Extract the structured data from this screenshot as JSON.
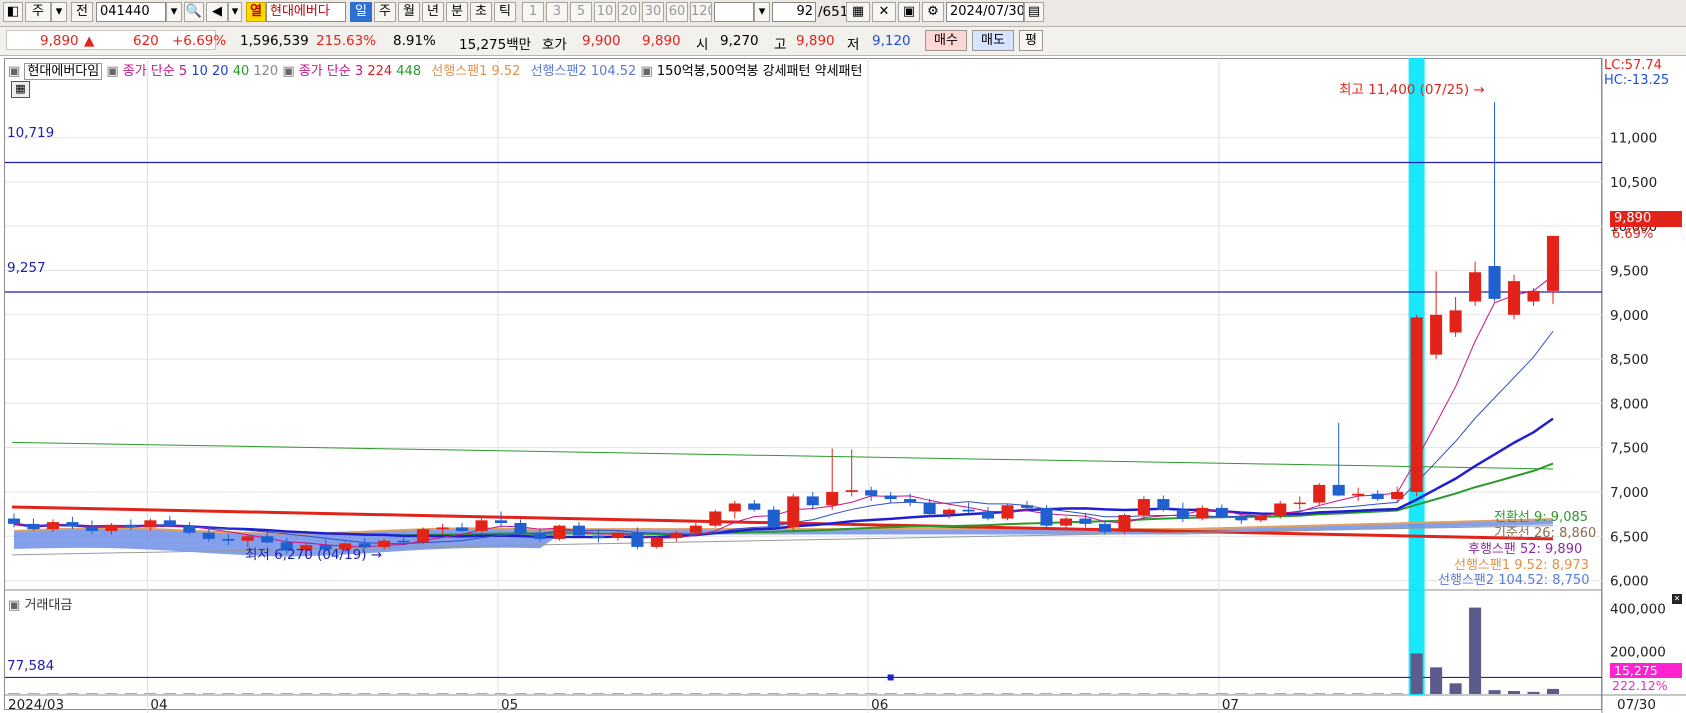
{
  "toolbar": {
    "market_label": "주",
    "prefix_label": "전",
    "code": "041440",
    "hot_label": "열",
    "stock_name": "현대에버다",
    "periods": [
      "일",
      "주",
      "월",
      "년",
      "분",
      "초",
      "틱"
    ],
    "selected_period": "일",
    "intervals": [
      "1",
      "3",
      "5",
      "10",
      "20",
      "30",
      "60",
      "120"
    ],
    "count_value": "92",
    "count_total": "/651",
    "date_value": "2024/07/30",
    "icons": [
      "layout-icon",
      "dropdown-icon",
      "search-icon",
      "speaker-icon",
      "settings-icon",
      "save-icon",
      "calendar-icon"
    ]
  },
  "quote": {
    "price": "9,890",
    "change_arrow": "▲",
    "change": "620",
    "change_pct": "+6.69%",
    "volume": "1,596,539",
    "volume_ratio": "215.63%",
    "turnover_pct": "8.91%",
    "trade_value": "15,275백만",
    "ask_label": "호가",
    "ask": "9,900",
    "bid": "9,890",
    "open_label": "시",
    "open": "9,270",
    "high_label": "고",
    "high": "9,890",
    "low_label": "저",
    "low": "9,120",
    "buy_label": "매수",
    "sell_label": "매도",
    "flat_label": "평"
  },
  "legend": {
    "name": "현대에버다임",
    "ma1": "종가 단순 5",
    "ma1_b": "10",
    "ma1_c": "20",
    "ma1_d": "40",
    "ma1_e": "120",
    "ma2": "종가 단순 3",
    "ma2_b": "224",
    "ma2_c": "448",
    "span1": "선행스팬1 9.52",
    "span2": "선행스팬2 104.52",
    "pattern": "150억봉,500억봉 강세패턴 약세패턴",
    "volume_panel": "거래대금"
  },
  "annotations": {
    "lc": "LC:57.74",
    "hc": "HC:-13.25",
    "high_note": "최고 11,400 (07/25)",
    "low_note": "최저 6,270 (04/19)",
    "line_10719": "10,719",
    "line_9257": "9,257",
    "vol_line": "77,584",
    "last_price": "9,890",
    "last_pct": "6.69%",
    "conv": "전환선 9: 9,085",
    "base": "기준선 26: 8,860",
    "lag": "후행스팬 52: 9,890",
    "lead1": "선행스팬1 9.52: 8,973",
    "lead2": "선행스팬2 104.52: 8,750",
    "vol_last": "15,275",
    "vol_pct": "222.12%"
  },
  "colors": {
    "up": "#e2231a",
    "down": "#1f5fd0",
    "highlight": "#00e5ff",
    "cloud": "#6f8fe8",
    "cloud_border": "#e0a060",
    "volume_bar": "#5b5b8c"
  },
  "chart_data": {
    "type": "candlestick",
    "y_axis_price": [
      "11,000",
      "10,500",
      "10,000",
      "9,500",
      "9,000",
      "8,500",
      "8,000",
      "7,500",
      "7,000",
      "6,500",
      "6,000"
    ],
    "y_axis_volume": [
      "400,000",
      "200,000"
    ],
    "x_labels": [
      "2024/03",
      "04",
      "05",
      "06",
      "07",
      "07/30"
    ],
    "ylim": [
      5950,
      11650
    ],
    "candles": [
      {
        "o": 6700,
        "h": 6760,
        "l": 6600,
        "c": 6640
      },
      {
        "o": 6640,
        "h": 6700,
        "l": 6560,
        "c": 6580
      },
      {
        "o": 6580,
        "h": 6690,
        "l": 6550,
        "c": 6660
      },
      {
        "o": 6660,
        "h": 6720,
        "l": 6580,
        "c": 6610
      },
      {
        "o": 6610,
        "h": 6680,
        "l": 6530,
        "c": 6560
      },
      {
        "o": 6560,
        "h": 6650,
        "l": 6520,
        "c": 6630
      },
      {
        "o": 6630,
        "h": 6690,
        "l": 6570,
        "c": 6600
      },
      {
        "o": 6600,
        "h": 6700,
        "l": 6560,
        "c": 6680
      },
      {
        "o": 6680,
        "h": 6730,
        "l": 6600,
        "c": 6620
      },
      {
        "o": 6620,
        "h": 6660,
        "l": 6520,
        "c": 6540
      },
      {
        "o": 6540,
        "h": 6600,
        "l": 6440,
        "c": 6470
      },
      {
        "o": 6470,
        "h": 6530,
        "l": 6400,
        "c": 6450
      },
      {
        "o": 6450,
        "h": 6520,
        "l": 6380,
        "c": 6500
      },
      {
        "o": 6500,
        "h": 6560,
        "l": 6420,
        "c": 6430
      },
      {
        "o": 6430,
        "h": 6480,
        "l": 6300,
        "c": 6340
      },
      {
        "o": 6340,
        "h": 6420,
        "l": 6270,
        "c": 6400
      },
      {
        "o": 6400,
        "h": 6460,
        "l": 6330,
        "c": 6350
      },
      {
        "o": 6350,
        "h": 6440,
        "l": 6320,
        "c": 6420
      },
      {
        "o": 6420,
        "h": 6480,
        "l": 6360,
        "c": 6380
      },
      {
        "o": 6380,
        "h": 6470,
        "l": 6350,
        "c": 6450
      },
      {
        "o": 6450,
        "h": 6510,
        "l": 6400,
        "c": 6430
      },
      {
        "o": 6430,
        "h": 6600,
        "l": 6410,
        "c": 6580
      },
      {
        "o": 6580,
        "h": 6640,
        "l": 6520,
        "c": 6600
      },
      {
        "o": 6600,
        "h": 6650,
        "l": 6540,
        "c": 6560
      },
      {
        "o": 6560,
        "h": 6700,
        "l": 6540,
        "c": 6680
      },
      {
        "o": 6680,
        "h": 6780,
        "l": 6600,
        "c": 6650
      },
      {
        "o": 6650,
        "h": 6690,
        "l": 6520,
        "c": 6540
      },
      {
        "o": 6540,
        "h": 6590,
        "l": 6440,
        "c": 6470
      },
      {
        "o": 6470,
        "h": 6630,
        "l": 6450,
        "c": 6620
      },
      {
        "o": 6620,
        "h": 6660,
        "l": 6500,
        "c": 6510
      },
      {
        "o": 6510,
        "h": 6560,
        "l": 6430,
        "c": 6480
      },
      {
        "o": 6480,
        "h": 6560,
        "l": 6450,
        "c": 6540
      },
      {
        "o": 6540,
        "h": 6600,
        "l": 6350,
        "c": 6380
      },
      {
        "o": 6380,
        "h": 6500,
        "l": 6360,
        "c": 6480
      },
      {
        "o": 6480,
        "h": 6560,
        "l": 6440,
        "c": 6540
      },
      {
        "o": 6540,
        "h": 6650,
        "l": 6500,
        "c": 6620
      },
      {
        "o": 6620,
        "h": 6800,
        "l": 6600,
        "c": 6780
      },
      {
        "o": 6780,
        "h": 6900,
        "l": 6700,
        "c": 6870
      },
      {
        "o": 6870,
        "h": 6910,
        "l": 6780,
        "c": 6800
      },
      {
        "o": 6800,
        "h": 6840,
        "l": 6580,
        "c": 6600
      },
      {
        "o": 6600,
        "h": 6980,
        "l": 6560,
        "c": 6950
      },
      {
        "o": 6950,
        "h": 7000,
        "l": 6800,
        "c": 6850
      },
      {
        "o": 6850,
        "h": 7490,
        "l": 6800,
        "c": 7000
      },
      {
        "o": 7000,
        "h": 7480,
        "l": 6950,
        "c": 7020
      },
      {
        "o": 7020,
        "h": 7060,
        "l": 6900,
        "c": 6960
      },
      {
        "o": 6960,
        "h": 7000,
        "l": 6880,
        "c": 6920
      },
      {
        "o": 6920,
        "h": 6980,
        "l": 6840,
        "c": 6880
      },
      {
        "o": 6880,
        "h": 6920,
        "l": 6720,
        "c": 6750
      },
      {
        "o": 6750,
        "h": 6820,
        "l": 6700,
        "c": 6800
      },
      {
        "o": 6800,
        "h": 6880,
        "l": 6760,
        "c": 6780
      },
      {
        "o": 6780,
        "h": 6830,
        "l": 6680,
        "c": 6700
      },
      {
        "o": 6700,
        "h": 6860,
        "l": 6680,
        "c": 6850
      },
      {
        "o": 6850,
        "h": 6900,
        "l": 6780,
        "c": 6820
      },
      {
        "o": 6820,
        "h": 6850,
        "l": 6600,
        "c": 6620
      },
      {
        "o": 6620,
        "h": 6720,
        "l": 6580,
        "c": 6700
      },
      {
        "o": 6700,
        "h": 6760,
        "l": 6600,
        "c": 6640
      },
      {
        "o": 6640,
        "h": 6680,
        "l": 6520,
        "c": 6550
      },
      {
        "o": 6550,
        "h": 6760,
        "l": 6520,
        "c": 6740
      },
      {
        "o": 6740,
        "h": 6950,
        "l": 6700,
        "c": 6920
      },
      {
        "o": 6920,
        "h": 6960,
        "l": 6780,
        "c": 6800
      },
      {
        "o": 6800,
        "h": 6880,
        "l": 6660,
        "c": 6700
      },
      {
        "o": 6700,
        "h": 6850,
        "l": 6680,
        "c": 6820
      },
      {
        "o": 6820,
        "h": 6860,
        "l": 6700,
        "c": 6720
      },
      {
        "o": 6720,
        "h": 6780,
        "l": 6640,
        "c": 6680
      },
      {
        "o": 6680,
        "h": 6750,
        "l": 6660,
        "c": 6730
      },
      {
        "o": 6730,
        "h": 6900,
        "l": 6700,
        "c": 6870
      },
      {
        "o": 6870,
        "h": 6950,
        "l": 6800,
        "c": 6880
      },
      {
        "o": 6880,
        "h": 7100,
        "l": 6850,
        "c": 7080
      },
      {
        "o": 7080,
        "h": 7780,
        "l": 6950,
        "c": 6960
      },
      {
        "o": 6960,
        "h": 7050,
        "l": 6900,
        "c": 6980
      },
      {
        "o": 6980,
        "h": 7020,
        "l": 6900,
        "c": 6920
      },
      {
        "o": 6920,
        "h": 7060,
        "l": 6880,
        "c": 7000
      },
      {
        "o": 7000,
        "h": 9000,
        "l": 6950,
        "c": 8970
      },
      {
        "o": 8550,
        "h": 9490,
        "l": 8500,
        "c": 9000
      },
      {
        "o": 8800,
        "h": 9200,
        "l": 8750,
        "c": 9050
      },
      {
        "o": 9150,
        "h": 9600,
        "l": 9100,
        "c": 9480
      },
      {
        "o": 9550,
        "h": 11400,
        "l": 9150,
        "c": 9180
      },
      {
        "o": 9000,
        "h": 9450,
        "l": 8950,
        "c": 9380
      },
      {
        "o": 9150,
        "h": 9300,
        "l": 9100,
        "c": 9270
      },
      {
        "o": 9270,
        "h": 9890,
        "l": 9120,
        "c": 9890
      }
    ],
    "volume_series": [
      3,
      3,
      3,
      3,
      3,
      3,
      3,
      3,
      3,
      3,
      3,
      3,
      3,
      3,
      3,
      3,
      3,
      3,
      3,
      3,
      3,
      3,
      3,
      3,
      3,
      3,
      3,
      3,
      3,
      3,
      3,
      3,
      3,
      3,
      3,
      3,
      3,
      3,
      3,
      3,
      3,
      3,
      4,
      4,
      3,
      3,
      3,
      3,
      3,
      3,
      3,
      3,
      3,
      3,
      3,
      3,
      3,
      3,
      3,
      3,
      3,
      3,
      3,
      3,
      3,
      3,
      14,
      30,
      10,
      8,
      8,
      10,
      190000,
      125000,
      50000,
      405000,
      18000,
      14000,
      10000,
      24000
    ],
    "ma_lines": [
      "5",
      "10",
      "20",
      "40",
      "120",
      "3",
      "224",
      "448"
    ]
  }
}
